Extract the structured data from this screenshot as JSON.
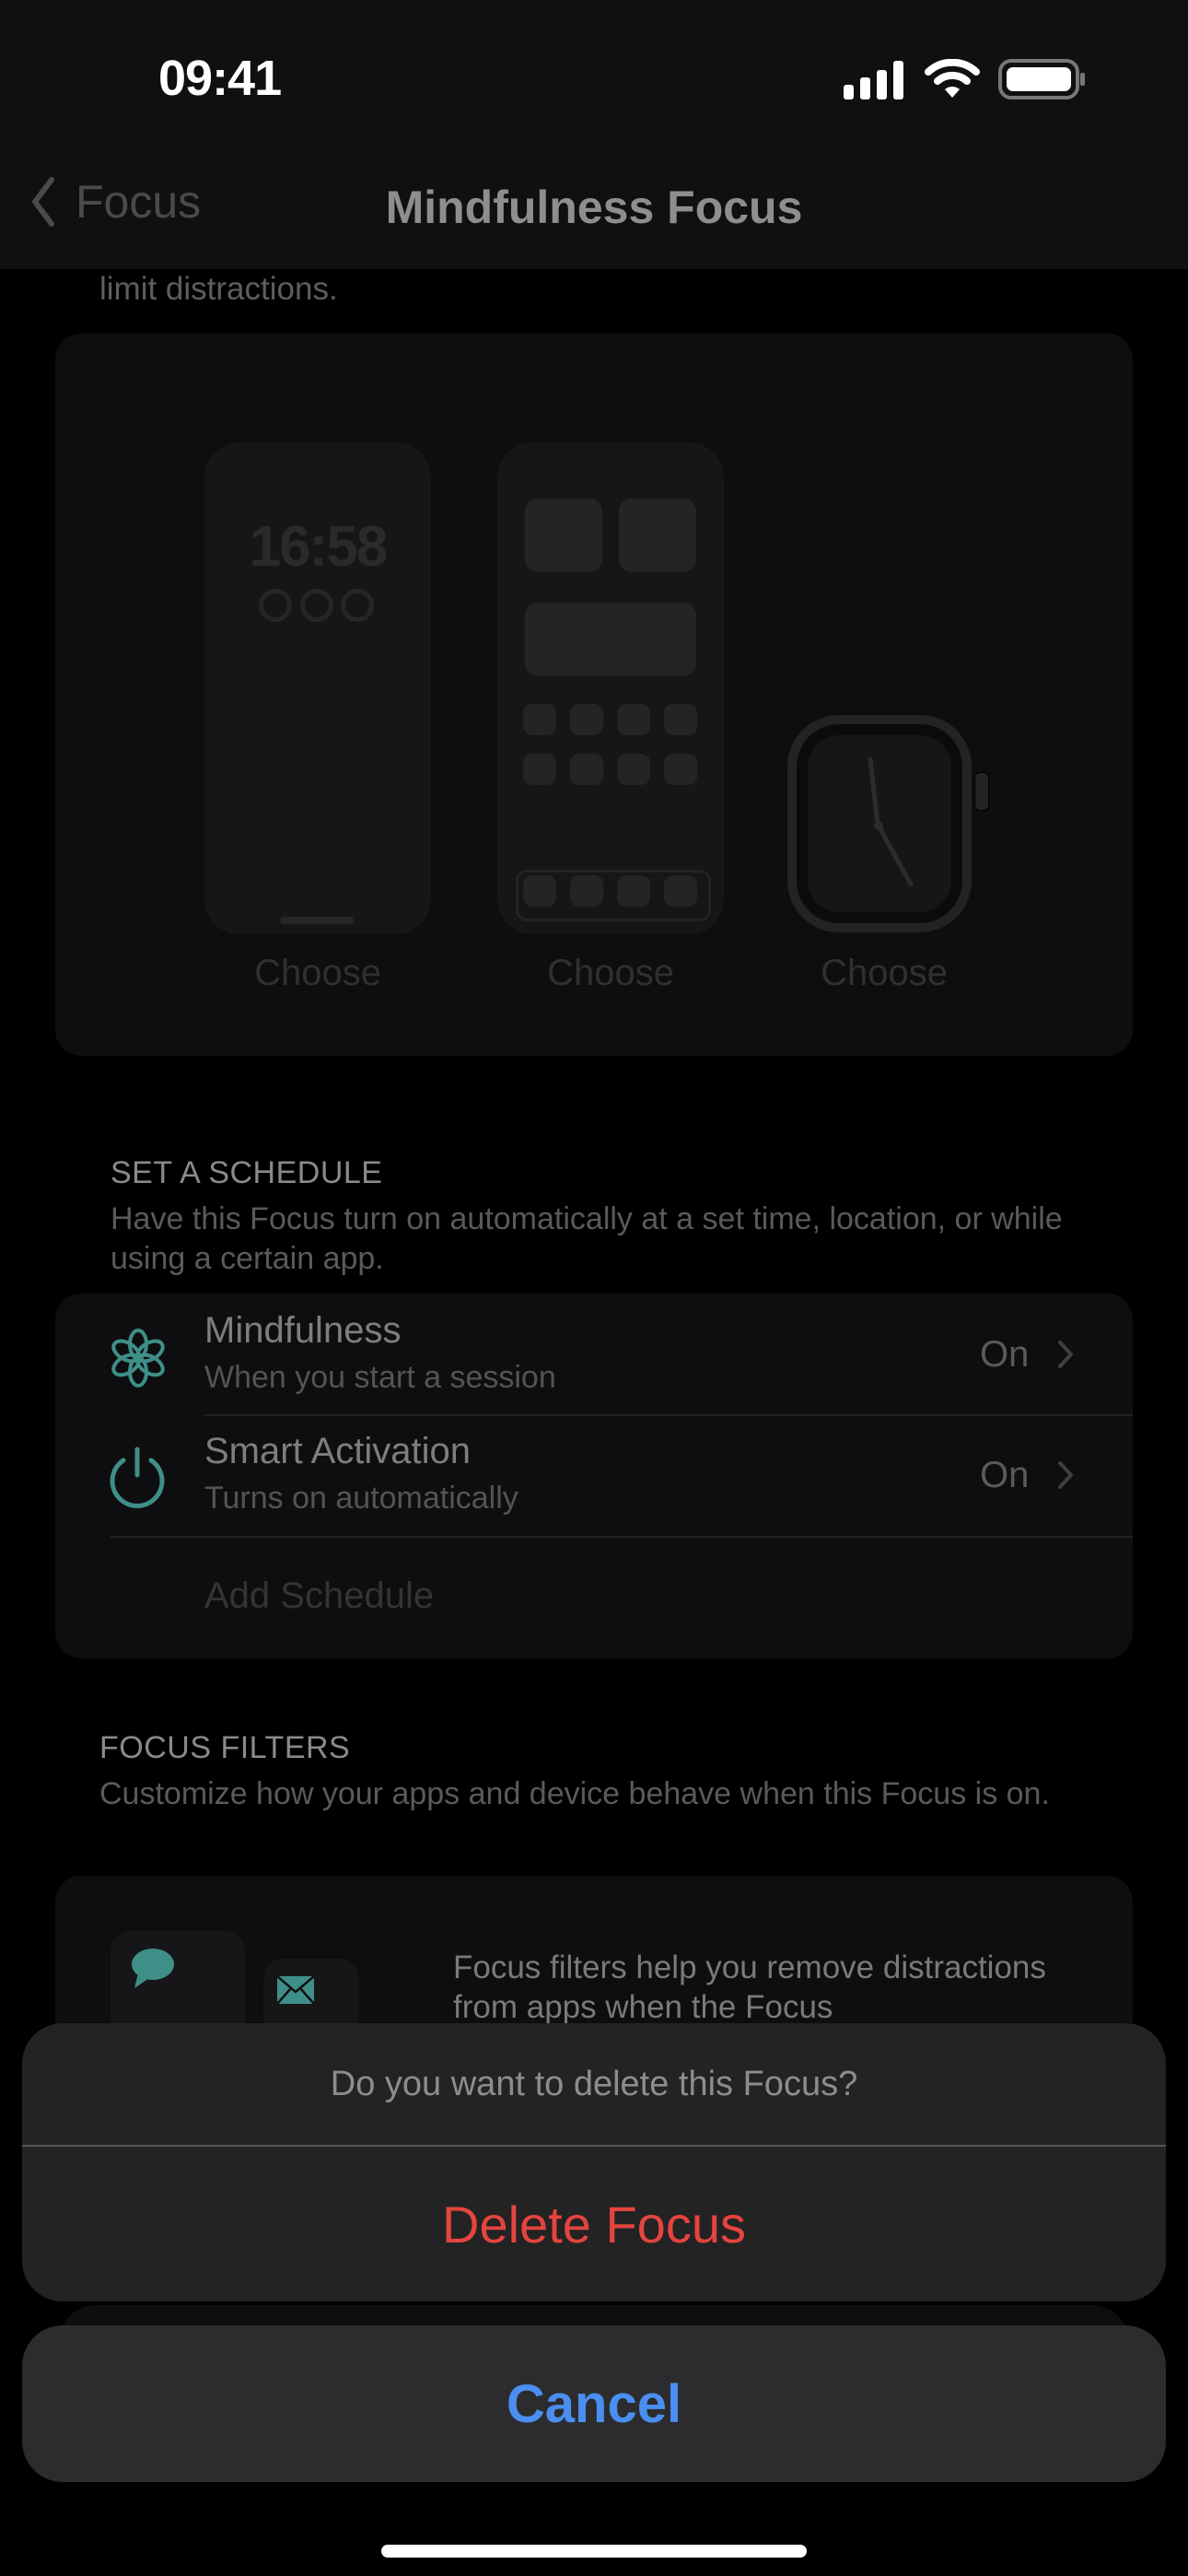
{
  "status_bar": {
    "time": "09:41",
    "icons": [
      "cellular-signal-icon",
      "wifi-icon",
      "battery-icon"
    ]
  },
  "nav": {
    "back_label": "Focus",
    "title": "Mindfulness Focus"
  },
  "intro": {
    "tail_text": "limit distractions."
  },
  "customize_screens": {
    "lock_screen_time": "16:58",
    "items": [
      {
        "label": "Choose",
        "kind": "lock-screen"
      },
      {
        "label": "Choose",
        "kind": "home-screen"
      },
      {
        "label": "Choose",
        "kind": "watch-face"
      }
    ]
  },
  "schedule": {
    "header": "SET A SCHEDULE",
    "description": "Have this Focus turn on automatically at a set time, location, or while using a certain app.",
    "rows": [
      {
        "icon": "mindfulness-flower-icon",
        "title": "Mindfulness",
        "subtitle": "When you start a session",
        "value": "On"
      },
      {
        "icon": "power-icon",
        "title": "Smart Activation",
        "subtitle": "Turns on automatically",
        "value": "On"
      }
    ],
    "add_label": "Add Schedule"
  },
  "filters": {
    "header": "FOCUS FILTERS",
    "description": "Customize how your apps and device behave when this Focus is on.",
    "card_text": "Focus filters help you remove distractions from apps when the Focus",
    "icons": [
      "message-bubble-icon",
      "mail-envelope-icon"
    ]
  },
  "action_sheet": {
    "message": "Do you want to delete this Focus?",
    "destructive_label": "Delete Focus",
    "cancel_label": "Cancel"
  },
  "colors": {
    "accent_teal": "#3f8f89",
    "destructive_red": "#e5443f",
    "cancel_blue": "#4a8ef0"
  }
}
